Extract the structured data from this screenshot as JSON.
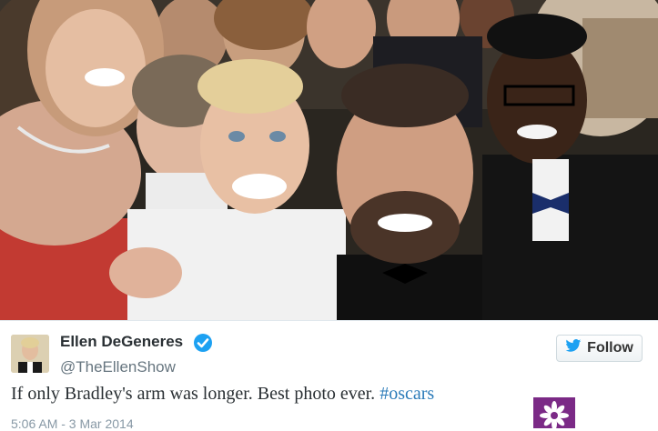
{
  "tweet": {
    "display_name": "Ellen DeGeneres",
    "handle": "@TheEllenShow",
    "text_prefix": "If only Bradley's arm was longer. Best photo ever. ",
    "hashtag": "#oscars",
    "timestamp": "5:06 AM - 3 Mar 2014",
    "verified": true
  },
  "follow_button": {
    "label": "Follow",
    "icon": "twitter-bird-icon"
  },
  "photo": {
    "subject": "group-selfie-photo"
  },
  "colors": {
    "link": "#2b7bb9",
    "verified_badge": "#1da1f2",
    "text": "#292f33",
    "secondary_text": "#66757f",
    "logo_background": "#7b2a86"
  }
}
